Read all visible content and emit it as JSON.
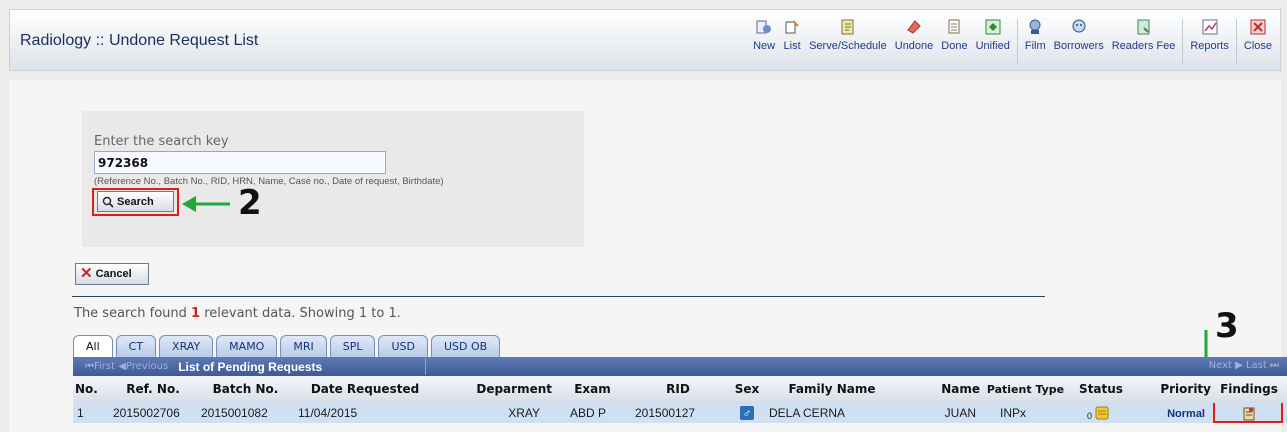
{
  "header": {
    "title": "Radiology :: Undone Request List",
    "toolbar": [
      {
        "label": "New",
        "icon": "new-request-icon",
        "color": "#5b6b8a"
      },
      {
        "label": "List",
        "icon": "list-icon",
        "color": "#c6882b"
      },
      {
        "label": "Serve/Schedule",
        "icon": "serve-schedule-icon",
        "color": "#3f8c3a"
      },
      {
        "label": "Undone",
        "icon": "undone-icon",
        "color": "#d0453b"
      },
      {
        "label": "Done",
        "icon": "done-icon",
        "color": "#8a6c3a"
      },
      {
        "label": "Unified",
        "icon": "unified-icon",
        "color": "#2f8a3e"
      },
      {
        "label": "Film",
        "icon": "film-icon",
        "color": "#3c5c8a"
      },
      {
        "label": "Borrowers",
        "icon": "borrowers-icon",
        "color": "#2d4f8a"
      },
      {
        "label": "Readers Fee",
        "icon": "readers-fee-icon",
        "color": "#3e8a55"
      },
      {
        "label": "Reports",
        "icon": "reports-icon",
        "color": "#b23a7a"
      },
      {
        "label": "Close",
        "icon": "close-icon",
        "color": "#c62828"
      }
    ]
  },
  "search": {
    "label": "Enter the search key",
    "value": "972368",
    "hint": "(Reference No., Batch No., RID, HRN, Name, Case no., Date of request, Birthdate)",
    "button_label": "Search"
  },
  "cancel_label": "Cancel",
  "annotations": {
    "step2": "2",
    "step3": "3"
  },
  "result": {
    "prefix": "The search found ",
    "count": "1",
    "suffix": " relevant data. Showing 1 to 1."
  },
  "tabs": [
    "All",
    "CT",
    "XRAY",
    "MAMO",
    "MRI",
    "SPL",
    "USD",
    "USD OB"
  ],
  "grid": {
    "pager_left": "⏮First ◀Previous",
    "caption": "List of Pending Requests",
    "pager_right": "Next ▶ Last ⏭",
    "columns": [
      "No.",
      "Ref. No.",
      "Batch No.",
      "Date Requested",
      "Deparment",
      "Exam",
      "RID",
      "Sex",
      "Family Name",
      "Name",
      "Patient Type",
      "Status",
      "Priority",
      "Findings"
    ],
    "rows": [
      {
        "no": "1",
        "ref": "2015002706",
        "batch": "2015001082",
        "date": "11/04/2015",
        "dept": "XRAY",
        "exam": "ABD P",
        "rid": "201500127",
        "sex": "♂",
        "family": "DELA CERNA",
        "name": "JUAN",
        "ptype": "INPx",
        "status": "0",
        "priority": "Normal"
      }
    ]
  }
}
